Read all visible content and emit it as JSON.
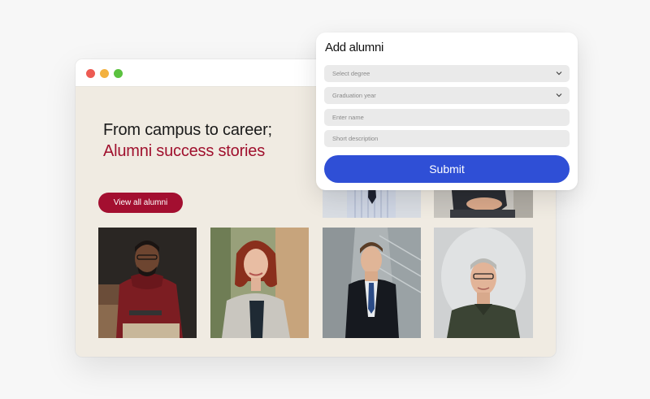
{
  "hero": {
    "title_line1": "From campus to career;",
    "title_line2": "Alumni success stories",
    "cta_label": "View all alumni"
  },
  "form": {
    "title": "Add alumni",
    "degree_placeholder": "Select degree",
    "year_placeholder": "Graduation year",
    "name_placeholder": "Enter name",
    "description_placeholder": "Short description",
    "submit_label": "Submit"
  },
  "colors": {
    "brand": "#a30f30",
    "accent_button": "#2f4fd6",
    "page_background": "#f0ebe2"
  }
}
